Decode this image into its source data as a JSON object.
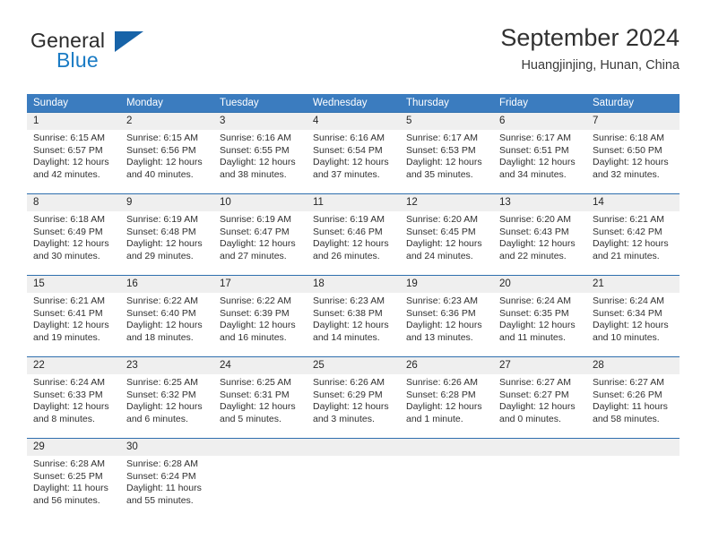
{
  "brand": {
    "name_top": "General",
    "name_bottom": "Blue",
    "triangle_color": "#1763a8",
    "blue_color": "#1a7bc4"
  },
  "header": {
    "title": "September 2024",
    "subtitle": "Huangjinjing, Hunan, China"
  },
  "theme": {
    "header_row_bg": "#3b7cbf",
    "header_row_text": "#ffffff",
    "daynum_bg": "#efefef",
    "separator": "#2f6fae"
  },
  "weekdays": [
    "Sunday",
    "Monday",
    "Tuesday",
    "Wednesday",
    "Thursday",
    "Friday",
    "Saturday"
  ],
  "labels": {
    "sunrise_prefix": "Sunrise: ",
    "sunset_prefix": "Sunset: ",
    "daylight_prefix": "Daylight: "
  },
  "weeks": [
    {
      "days": [
        {
          "num": "1",
          "sunrise": "Sunrise: 6:15 AM",
          "sunset": "Sunset: 6:57 PM",
          "daylight1": "Daylight: 12 hours",
          "daylight2": "and 42 minutes."
        },
        {
          "num": "2",
          "sunrise": "Sunrise: 6:15 AM",
          "sunset": "Sunset: 6:56 PM",
          "daylight1": "Daylight: 12 hours",
          "daylight2": "and 40 minutes."
        },
        {
          "num": "3",
          "sunrise": "Sunrise: 6:16 AM",
          "sunset": "Sunset: 6:55 PM",
          "daylight1": "Daylight: 12 hours",
          "daylight2": "and 38 minutes."
        },
        {
          "num": "4",
          "sunrise": "Sunrise: 6:16 AM",
          "sunset": "Sunset: 6:54 PM",
          "daylight1": "Daylight: 12 hours",
          "daylight2": "and 37 minutes."
        },
        {
          "num": "5",
          "sunrise": "Sunrise: 6:17 AM",
          "sunset": "Sunset: 6:53 PM",
          "daylight1": "Daylight: 12 hours",
          "daylight2": "and 35 minutes."
        },
        {
          "num": "6",
          "sunrise": "Sunrise: 6:17 AM",
          "sunset": "Sunset: 6:51 PM",
          "daylight1": "Daylight: 12 hours",
          "daylight2": "and 34 minutes."
        },
        {
          "num": "7",
          "sunrise": "Sunrise: 6:18 AM",
          "sunset": "Sunset: 6:50 PM",
          "daylight1": "Daylight: 12 hours",
          "daylight2": "and 32 minutes."
        }
      ]
    },
    {
      "days": [
        {
          "num": "8",
          "sunrise": "Sunrise: 6:18 AM",
          "sunset": "Sunset: 6:49 PM",
          "daylight1": "Daylight: 12 hours",
          "daylight2": "and 30 minutes."
        },
        {
          "num": "9",
          "sunrise": "Sunrise: 6:19 AM",
          "sunset": "Sunset: 6:48 PM",
          "daylight1": "Daylight: 12 hours",
          "daylight2": "and 29 minutes."
        },
        {
          "num": "10",
          "sunrise": "Sunrise: 6:19 AM",
          "sunset": "Sunset: 6:47 PM",
          "daylight1": "Daylight: 12 hours",
          "daylight2": "and 27 minutes."
        },
        {
          "num": "11",
          "sunrise": "Sunrise: 6:19 AM",
          "sunset": "Sunset: 6:46 PM",
          "daylight1": "Daylight: 12 hours",
          "daylight2": "and 26 minutes."
        },
        {
          "num": "12",
          "sunrise": "Sunrise: 6:20 AM",
          "sunset": "Sunset: 6:45 PM",
          "daylight1": "Daylight: 12 hours",
          "daylight2": "and 24 minutes."
        },
        {
          "num": "13",
          "sunrise": "Sunrise: 6:20 AM",
          "sunset": "Sunset: 6:43 PM",
          "daylight1": "Daylight: 12 hours",
          "daylight2": "and 22 minutes."
        },
        {
          "num": "14",
          "sunrise": "Sunrise: 6:21 AM",
          "sunset": "Sunset: 6:42 PM",
          "daylight1": "Daylight: 12 hours",
          "daylight2": "and 21 minutes."
        }
      ]
    },
    {
      "days": [
        {
          "num": "15",
          "sunrise": "Sunrise: 6:21 AM",
          "sunset": "Sunset: 6:41 PM",
          "daylight1": "Daylight: 12 hours",
          "daylight2": "and 19 minutes."
        },
        {
          "num": "16",
          "sunrise": "Sunrise: 6:22 AM",
          "sunset": "Sunset: 6:40 PM",
          "daylight1": "Daylight: 12 hours",
          "daylight2": "and 18 minutes."
        },
        {
          "num": "17",
          "sunrise": "Sunrise: 6:22 AM",
          "sunset": "Sunset: 6:39 PM",
          "daylight1": "Daylight: 12 hours",
          "daylight2": "and 16 minutes."
        },
        {
          "num": "18",
          "sunrise": "Sunrise: 6:23 AM",
          "sunset": "Sunset: 6:38 PM",
          "daylight1": "Daylight: 12 hours",
          "daylight2": "and 14 minutes."
        },
        {
          "num": "19",
          "sunrise": "Sunrise: 6:23 AM",
          "sunset": "Sunset: 6:36 PM",
          "daylight1": "Daylight: 12 hours",
          "daylight2": "and 13 minutes."
        },
        {
          "num": "20",
          "sunrise": "Sunrise: 6:24 AM",
          "sunset": "Sunset: 6:35 PM",
          "daylight1": "Daylight: 12 hours",
          "daylight2": "and 11 minutes."
        },
        {
          "num": "21",
          "sunrise": "Sunrise: 6:24 AM",
          "sunset": "Sunset: 6:34 PM",
          "daylight1": "Daylight: 12 hours",
          "daylight2": "and 10 minutes."
        }
      ]
    },
    {
      "days": [
        {
          "num": "22",
          "sunrise": "Sunrise: 6:24 AM",
          "sunset": "Sunset: 6:33 PM",
          "daylight1": "Daylight: 12 hours",
          "daylight2": "and 8 minutes."
        },
        {
          "num": "23",
          "sunrise": "Sunrise: 6:25 AM",
          "sunset": "Sunset: 6:32 PM",
          "daylight1": "Daylight: 12 hours",
          "daylight2": "and 6 minutes."
        },
        {
          "num": "24",
          "sunrise": "Sunrise: 6:25 AM",
          "sunset": "Sunset: 6:31 PM",
          "daylight1": "Daylight: 12 hours",
          "daylight2": "and 5 minutes."
        },
        {
          "num": "25",
          "sunrise": "Sunrise: 6:26 AM",
          "sunset": "Sunset: 6:29 PM",
          "daylight1": "Daylight: 12 hours",
          "daylight2": "and 3 minutes."
        },
        {
          "num": "26",
          "sunrise": "Sunrise: 6:26 AM",
          "sunset": "Sunset: 6:28 PM",
          "daylight1": "Daylight: 12 hours",
          "daylight2": "and 1 minute."
        },
        {
          "num": "27",
          "sunrise": "Sunrise: 6:27 AM",
          "sunset": "Sunset: 6:27 PM",
          "daylight1": "Daylight: 12 hours",
          "daylight2": "and 0 minutes."
        },
        {
          "num": "28",
          "sunrise": "Sunrise: 6:27 AM",
          "sunset": "Sunset: 6:26 PM",
          "daylight1": "Daylight: 11 hours",
          "daylight2": "and 58 minutes."
        }
      ]
    },
    {
      "days": [
        {
          "num": "29",
          "sunrise": "Sunrise: 6:28 AM",
          "sunset": "Sunset: 6:25 PM",
          "daylight1": "Daylight: 11 hours",
          "daylight2": "and 56 minutes."
        },
        {
          "num": "30",
          "sunrise": "Sunrise: 6:28 AM",
          "sunset": "Sunset: 6:24 PM",
          "daylight1": "Daylight: 11 hours",
          "daylight2": "and 55 minutes."
        },
        {
          "num": "",
          "sunrise": "",
          "sunset": "",
          "daylight1": "",
          "daylight2": ""
        },
        {
          "num": "",
          "sunrise": "",
          "sunset": "",
          "daylight1": "",
          "daylight2": ""
        },
        {
          "num": "",
          "sunrise": "",
          "sunset": "",
          "daylight1": "",
          "daylight2": ""
        },
        {
          "num": "",
          "sunrise": "",
          "sunset": "",
          "daylight1": "",
          "daylight2": ""
        },
        {
          "num": "",
          "sunrise": "",
          "sunset": "",
          "daylight1": "",
          "daylight2": ""
        }
      ]
    }
  ]
}
